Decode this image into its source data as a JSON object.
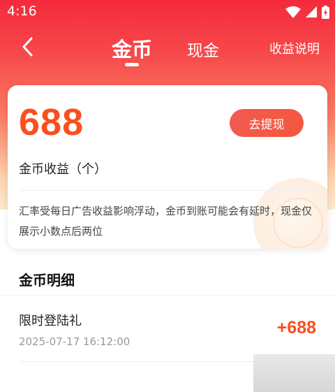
{
  "status_bar": {
    "time": "4:16",
    "icons": [
      "wifi-icon",
      "signal-icon",
      "battery-icon"
    ]
  },
  "header": {
    "back_icon": "chevron-left-icon",
    "tabs": [
      {
        "label": "金币",
        "active": true
      },
      {
        "label": "现金",
        "active": false
      }
    ],
    "explain_label": "收益说明"
  },
  "card": {
    "amount": "688",
    "withdraw_label": "去提现",
    "amount_label": "金币收益（个）",
    "notice": "汇率受每日广告收益影响浮动，金币到账可能会有延时，现金仅展示小数点后两位"
  },
  "details": {
    "title": "金币明细",
    "records": [
      {
        "title": "限时登陆礼",
        "time": "2025-07-17 16:12:00",
        "amount": "+688"
      }
    ]
  },
  "colors": {
    "header_gradient_top": "#f42a3c",
    "accent_orange": "#fa4f1c",
    "button_red": "#f15a4f"
  }
}
